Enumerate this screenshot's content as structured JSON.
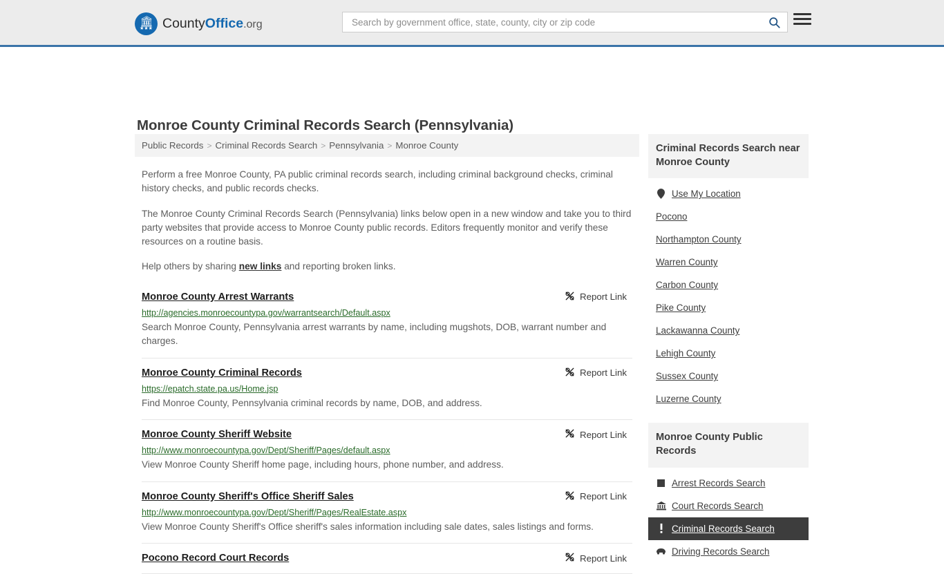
{
  "header": {
    "logo": {
      "part1": "County",
      "part2": "Office",
      "part3": ".org",
      "icon": "eagle-seal-icon"
    },
    "search": {
      "placeholder": "Search by government office, state, county, city or zip code",
      "value": "",
      "button_icon": "search-icon"
    },
    "menu_icon": "hamburger-menu-icon"
  },
  "page": {
    "title": "Monroe County Criminal Records Search (Pennsylvania)"
  },
  "breadcrumb": {
    "items": [
      "Public Records",
      "Criminal Records Search",
      "Pennsylvania",
      "Monroe County"
    ],
    "separator": ">"
  },
  "intro": {
    "p1": "Perform a free Monroe County, PA public criminal records search, including criminal background checks, criminal history checks, and public records checks.",
    "p2": "The Monroe County Criminal Records Search (Pennsylvania) links below open in a new window and take you to third party websites that provide access to Monroe County public records. Editors frequently monitor and verify these resources on a routine basis.",
    "p3_before": "Help others by sharing ",
    "p3_link": "new links",
    "p3_after": " and reporting broken links."
  },
  "results": {
    "report_label": "Report Link",
    "report_icon": "broken-link-icon",
    "items": [
      {
        "title": "Monroe County Arrest Warrants",
        "url": "http://agencies.monroecountypa.gov/warrantsearch/Default.aspx",
        "desc": "Search Monroe County, Pennsylvania arrest warrants by name, including mugshots, DOB, warrant number and charges."
      },
      {
        "title": "Monroe County Criminal Records",
        "url": "https://epatch.state.pa.us/Home.jsp",
        "desc": "Find Monroe County, Pennsylvania criminal records by name, DOB, and address."
      },
      {
        "title": "Monroe County Sheriff Website",
        "url": "http://www.monroecountypa.gov/Dept/Sheriff/Pages/default.aspx",
        "desc": "View Monroe County Sheriff home page, including hours, phone number, and address."
      },
      {
        "title": "Monroe County Sheriff's Office Sheriff Sales",
        "url": "http://www.monroecountypa.gov/Dept/Sheriff/Pages/RealEstate.aspx",
        "desc": "View Monroe County Sheriff's Office sheriff's sales information including sale dates, sales listings and forms."
      },
      {
        "title": "Pocono Record Court Records",
        "url": "",
        "desc": ""
      }
    ]
  },
  "sidebar": {
    "nearby": {
      "heading": "Criminal Records Search near Monroe County",
      "items": [
        {
          "label": "Use My Location",
          "icon": "map-pin-icon"
        },
        {
          "label": "Pocono",
          "icon": ""
        },
        {
          "label": "Northampton County",
          "icon": ""
        },
        {
          "label": "Warren County",
          "icon": ""
        },
        {
          "label": "Carbon County",
          "icon": ""
        },
        {
          "label": "Pike County",
          "icon": ""
        },
        {
          "label": "Lackawanna County",
          "icon": ""
        },
        {
          "label": "Lehigh County",
          "icon": ""
        },
        {
          "label": "Sussex County",
          "icon": ""
        },
        {
          "label": "Luzerne County",
          "icon": ""
        }
      ]
    },
    "public_records": {
      "heading": "Monroe County Public Records",
      "items": [
        {
          "label": "Arrest Records Search",
          "icon": "fingerprint-square-icon",
          "active": false
        },
        {
          "label": "Court Records Search",
          "icon": "courthouse-icon",
          "active": false
        },
        {
          "label": "Criminal Records Search",
          "icon": "exclamation-icon",
          "active": true
        },
        {
          "label": "Driving Records Search",
          "icon": "car-icon",
          "active": false
        }
      ]
    }
  },
  "colors": {
    "accent_blue": "#1569b0",
    "header_bg": "#ececec",
    "header_border": "#3a73a8",
    "url_green": "#2a6b2a",
    "active_bg": "#3d3d3d"
  }
}
